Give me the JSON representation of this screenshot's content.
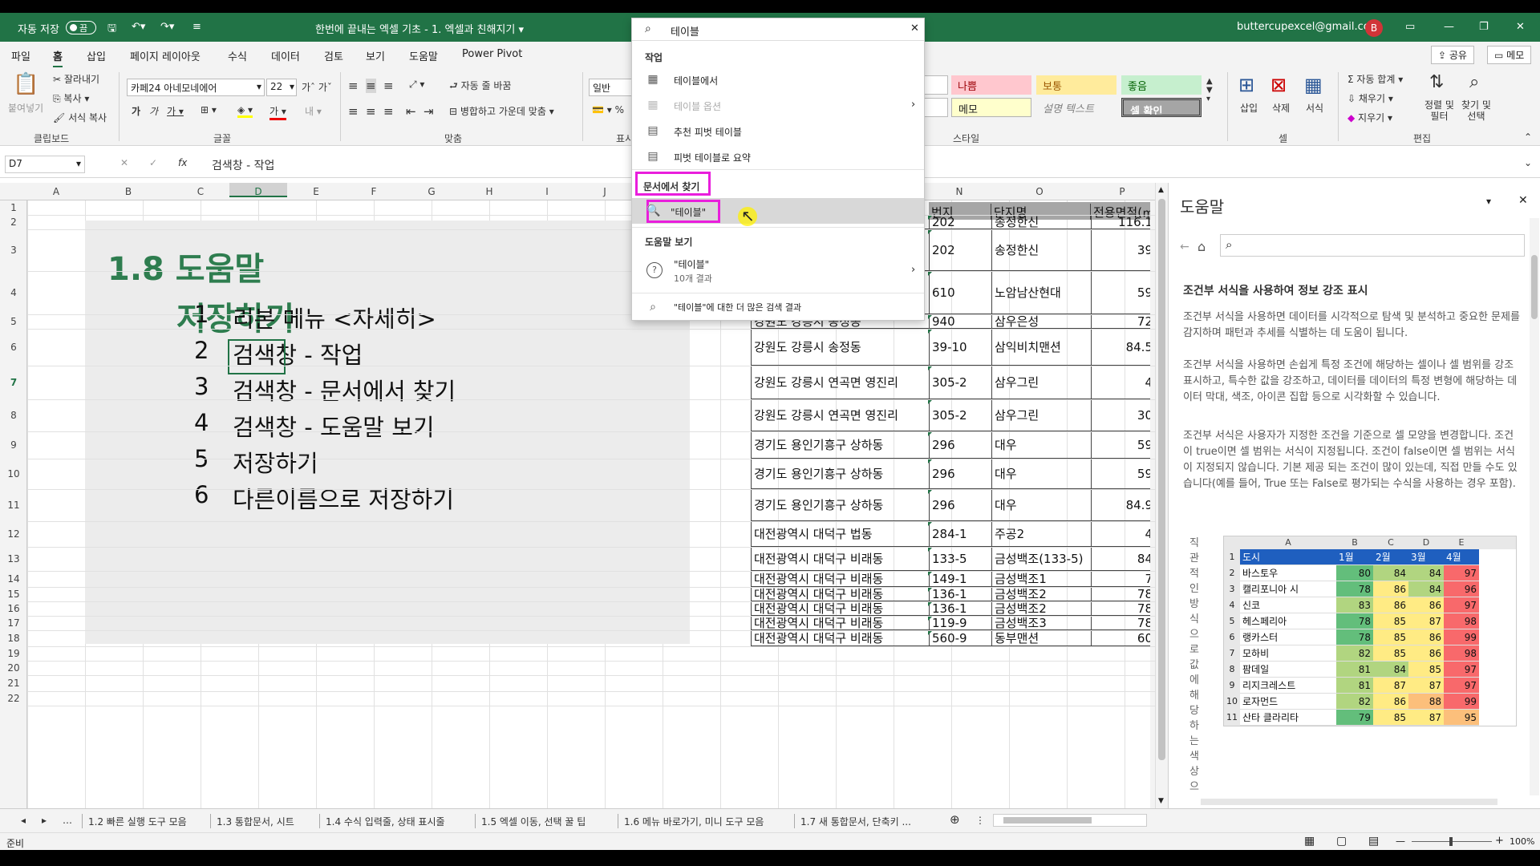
{
  "titlebar": {
    "autosave": "자동 저장",
    "autosave_state": "끔",
    "doc_title": "한번에 끝내는 엑셀 기초 - 1. 엑셀과 친해지기 ▾",
    "account": "buttercupexcel@gmail.com",
    "avatar": "B"
  },
  "ribbon_tabs": [
    "파일",
    "홈",
    "삽입",
    "페이지 레이아웃",
    "수식",
    "데이터",
    "검토",
    "보기",
    "도움말",
    "Power Pivot"
  ],
  "share_label": "공유",
  "memo_label": "메모",
  "ribbon": {
    "clipboard": {
      "paste": "붙여넣기",
      "cut": "잘라내기",
      "copy": "복사",
      "format_painter": "서식 복사",
      "group": "클립보드"
    },
    "font": {
      "name": "카페24 아네모네에어",
      "size": "22",
      "group": "글꼴"
    },
    "align": {
      "wrap": "자동 줄 바꿈",
      "merge": "병합하고 가운데 맞춤",
      "group": "맞춤"
    },
    "number": {
      "format": "일반",
      "group": "표시"
    },
    "styles": {
      "bad": "나쁨",
      "neutral": "보통",
      "good": "좋음",
      "note": "메모",
      "explanatory": "설명 텍스트",
      "check": "셀 확인",
      "group": "스타일"
    },
    "cells": {
      "insert": "삽입",
      "delete": "삭제",
      "format": "서식",
      "group": "셀"
    },
    "editing": {
      "autosum": "자동 합계",
      "fill": "채우기",
      "clear": "지우기",
      "sort": "정렬 및\n필터",
      "find": "찾기 및\n선택",
      "group": "편집"
    }
  },
  "formula": {
    "namebox": "D7",
    "fx": "fx",
    "content": "검색창 - 작업"
  },
  "columns": [
    "A",
    "B",
    "C",
    "D",
    "E",
    "F",
    "G",
    "H",
    "I",
    "J",
    "N",
    "O",
    "P"
  ],
  "rows": [
    "1",
    "2",
    "3",
    "4",
    "5",
    "6",
    "7",
    "8",
    "9",
    "10",
    "11",
    "12",
    "13",
    "14",
    "15",
    "16",
    "17",
    "18",
    "19",
    "20",
    "21",
    "22"
  ],
  "slide": {
    "title1": "1.8 도움말",
    "title2": "저장하기",
    "items": [
      {
        "n": "1",
        "t": "리본 메뉴 <자세히>"
      },
      {
        "n": "2",
        "t": "검색창 - 작업"
      },
      {
        "n": "3",
        "t": "검색창 - 문서에서 찾기"
      },
      {
        "n": "4",
        "t": "검색창 - 도움말 보기"
      },
      {
        "n": "5",
        "t": "저장하기"
      },
      {
        "n": "6",
        "t": "다른이름으로 저장하기"
      }
    ]
  },
  "table": {
    "headers": [
      "번지",
      "단지명",
      "전용면적(㎡"
    ],
    "rows": [
      [
        "",
        "202",
        "송정한신",
        "116.1"
      ],
      [
        "",
        "202",
        "송정한신",
        "39"
      ],
      [
        "",
        "610",
        "노암남산현대",
        "59"
      ],
      [
        "강원도 강릉시 송정동",
        "940",
        "삼우은성",
        "72"
      ],
      [
        "강원도 강릉시 송정동",
        "39-10",
        "삼익비치맨션",
        "84.5"
      ],
      [
        "강원도 강릉시 연곡면 영진리",
        "305-2",
        "삼우그린",
        "4"
      ],
      [
        "강원도 강릉시 연곡면 영진리",
        "305-2",
        "삼우그린",
        "30"
      ],
      [
        "경기도 용인기흥구 상하동",
        "296",
        "대우",
        "59"
      ],
      [
        "경기도 용인기흥구 상하동",
        "296",
        "대우",
        "59"
      ],
      [
        "경기도 용인기흥구 상하동",
        "296",
        "대우",
        "84.9"
      ],
      [
        "대전광역시 대덕구 법동",
        "284-1",
        "주공2",
        "4"
      ],
      [
        "대전광역시 대덕구 비래동",
        "133-5",
        "금성백조(133-5)",
        "84"
      ],
      [
        "대전광역시 대덕구 비래동",
        "149-1",
        "금성백조1",
        "7"
      ],
      [
        "대전광역시 대덕구 비래동",
        "136-1",
        "금성백조2",
        "78"
      ],
      [
        "대전광역시 대덕구 비래동",
        "136-1",
        "금성백조2",
        "78"
      ],
      [
        "대전광역시 대덕구 비래동",
        "119-9",
        "금성백조3",
        "78"
      ],
      [
        "대전광역시 대덕구 비래동",
        "560-9",
        "동부맨션",
        "60"
      ]
    ]
  },
  "search": {
    "query": "테이블",
    "h_actions": "작업",
    "actions": [
      "테이블에서",
      "테이블 옵션",
      "추천 피벗 테이블",
      "피벗 테이블로 요약"
    ],
    "h_doc": "문서에서 찾기",
    "doc_item": "\"테이블\"",
    "h_help": "도움말 보기",
    "help_item": "\"테이블\"",
    "help_count": "10개 결과",
    "more": "\"테이블\"에 대한 더 많은 검색 결과"
  },
  "help": {
    "title": "도움말",
    "heading": "조건부 서식을 사용하여 정보 강조 표시",
    "p1": "조건부 서식을 사용하면 데이터를 시각적으로 탐색 및 분석하고 중요한 문제를 감지하며 패턴과 추세를 식별하는 데 도움이 됩니다.",
    "p2": "조건부 서식을 사용하면 손쉽게 특정 조건에 해당하는 셀이나 셀 범위를 강조 표시하고, 특수한 값을 강조하고, 데이터를 데이터의 특정 변형에 해당하는 데이터 막대, 색조, 아이콘 집합 등으로 시각화할 수 있습니다.",
    "p3": "조건부 서식은 사용자가 지정한 조건을 기준으로 셀 모양을 변경합니다. 조건이 true이면 셀 범위는 서식이 지정됩니다. 조건이 false이면 셀 범위는 서식이 지정되지 않습니다. 기본 제공 되는 조건이 많이 있는데, 직접 만들 수도 있습니다(예를 들어, True 또는 False로 평가되는 수식을 사용하는 경우 포함).",
    "vertical": "직관적인방식으로값에해당하는색상으",
    "mini": {
      "cols": [
        "A",
        "B",
        "C",
        "D",
        "E"
      ],
      "head": [
        "도시",
        "1월",
        "2월",
        "3월",
        "4월"
      ],
      "rows": [
        [
          "바스토우",
          "80",
          "84",
          "84",
          "97"
        ],
        [
          "캘리포니아 시",
          "78",
          "86",
          "84",
          "96"
        ],
        [
          "신코",
          "83",
          "86",
          "86",
          "97"
        ],
        [
          "헤스페리아",
          "78",
          "85",
          "87",
          "98"
        ],
        [
          "랭카스터",
          "78",
          "85",
          "86",
          "99"
        ],
        [
          "모하비",
          "82",
          "85",
          "86",
          "98"
        ],
        [
          "팜데일",
          "81",
          "84",
          "85",
          "97"
        ],
        [
          "리지크레스트",
          "81",
          "87",
          "87",
          "97"
        ],
        [
          "로자먼드",
          "82",
          "86",
          "88",
          "99"
        ],
        [
          "산타 클라리타",
          "79",
          "85",
          "87",
          "95"
        ]
      ]
    }
  },
  "sheet_tabs": [
    "1.2 빠른 실행 도구 모음",
    "1.3 통합문서, 시트",
    "1.4 수식 입력줄, 상태 표시줄",
    "1.5 엑셀 이동, 선택 꿀 팁",
    "1.6 메뉴 바로가기, 미니 도구 모음",
    "1.7 새 통합문서, 단축키 ..."
  ],
  "status": {
    "ready": "준비",
    "zoom": "100%"
  }
}
